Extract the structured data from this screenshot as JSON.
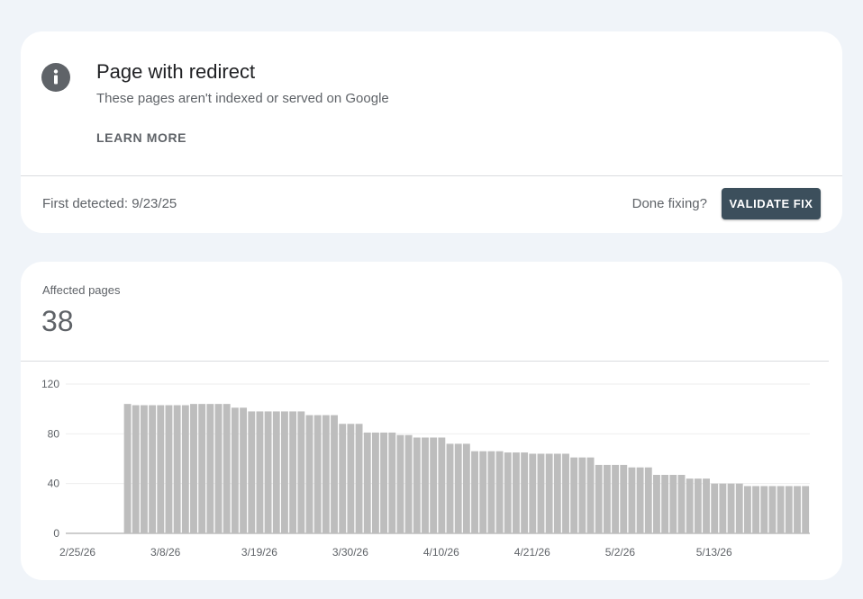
{
  "issue": {
    "title": "Page with redirect",
    "subtitle": "These pages aren't indexed or served on Google",
    "learn_more": "LEARN MORE",
    "first_detected": "First detected: 9/23/25",
    "done_fixing": "Done fixing?",
    "validate_fix": "VALIDATE FIX"
  },
  "icons": {
    "issue_icon": "info-icon"
  },
  "colors": {
    "button": "#3c4f5c",
    "bar": "#bdbdbd",
    "icon": "#5f6368"
  },
  "affected": {
    "label": "Affected pages",
    "value": "38"
  },
  "chart_data": {
    "type": "bar",
    "ylim": [
      0,
      120
    ],
    "y_ticks": [
      0,
      40,
      80,
      120
    ],
    "grid": true,
    "x_tick_labels": [
      "2/25/26",
      "3/8/26",
      "3/19/26",
      "3/30/26",
      "4/10/26",
      "4/21/26",
      "5/2/26",
      "5/13/26"
    ],
    "x_start": "2/25/26",
    "x_end": "5/25/26",
    "values": [
      0,
      0,
      0,
      0,
      0,
      0,
      0,
      104,
      103,
      103,
      103,
      103,
      103,
      103,
      103,
      104,
      104,
      104,
      104,
      104,
      101,
      101,
      98,
      98,
      98,
      98,
      98,
      98,
      98,
      95,
      95,
      95,
      95,
      88,
      88,
      88,
      81,
      81,
      81,
      81,
      79,
      79,
      77,
      77,
      77,
      77,
      72,
      72,
      72,
      66,
      66,
      66,
      66,
      65,
      65,
      65,
      64,
      64,
      64,
      64,
      64,
      61,
      61,
      61,
      55,
      55,
      55,
      55,
      53,
      53,
      53,
      47,
      47,
      47,
      47,
      44,
      44,
      44,
      40,
      40,
      40,
      40,
      38,
      38,
      38,
      38,
      38,
      38,
      38,
      38
    ]
  }
}
